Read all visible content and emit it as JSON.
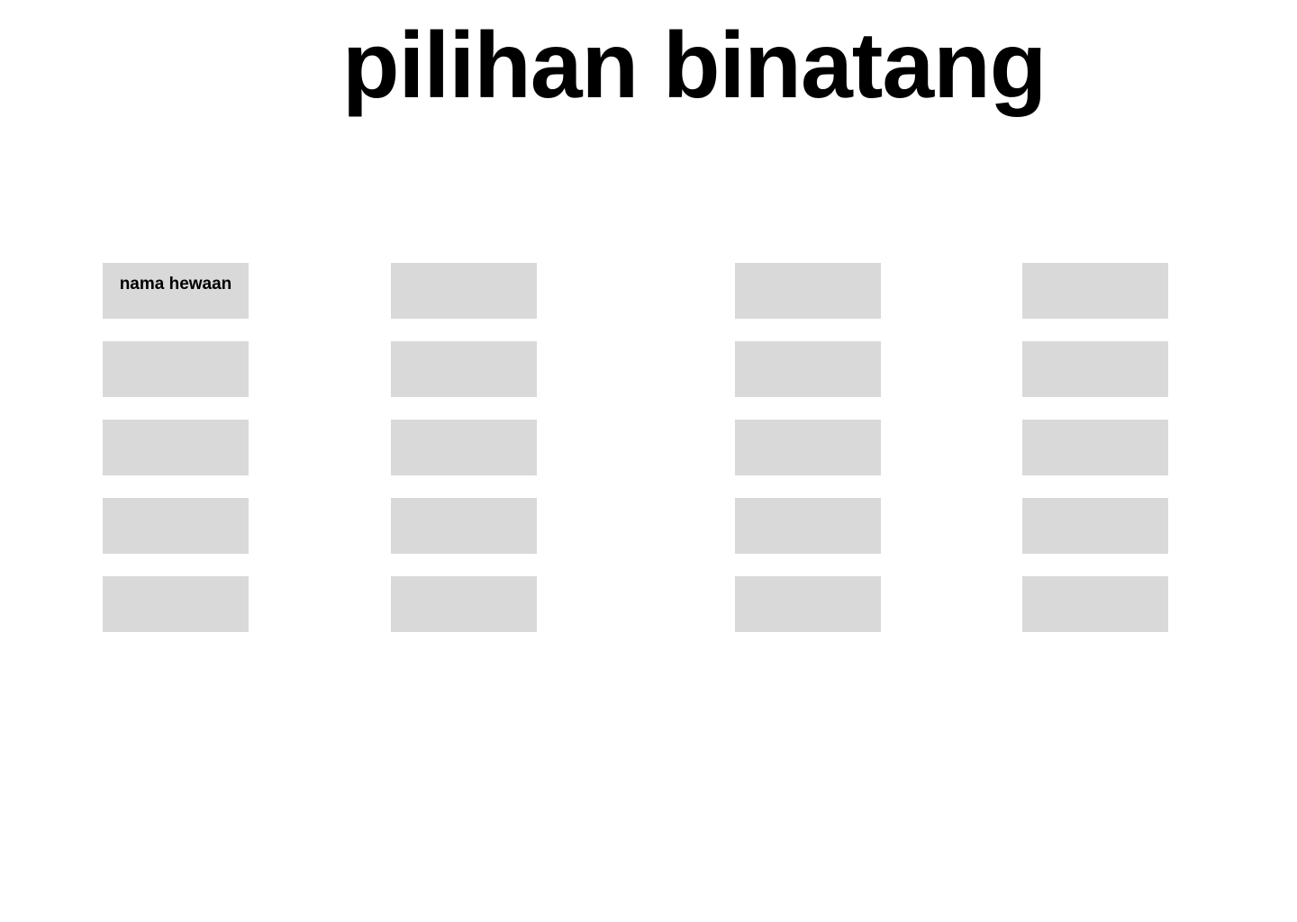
{
  "page": {
    "title": "pilihan binatang"
  },
  "colors": {
    "background": "#ffffff",
    "tile": "#d9d9d9",
    "text": "#000000"
  },
  "grid": {
    "columns": [
      {
        "tiles": [
          {
            "label": "nama hewaan"
          },
          {
            "label": ""
          },
          {
            "label": ""
          },
          {
            "label": ""
          },
          {
            "label": ""
          }
        ]
      },
      {
        "tiles": [
          {
            "label": ""
          },
          {
            "label": ""
          },
          {
            "label": ""
          },
          {
            "label": ""
          },
          {
            "label": ""
          }
        ]
      },
      {
        "tiles": [
          {
            "label": ""
          },
          {
            "label": ""
          },
          {
            "label": ""
          },
          {
            "label": ""
          },
          {
            "label": ""
          }
        ]
      },
      {
        "tiles": [
          {
            "label": ""
          },
          {
            "label": ""
          },
          {
            "label": ""
          },
          {
            "label": ""
          },
          {
            "label": ""
          }
        ]
      }
    ]
  }
}
